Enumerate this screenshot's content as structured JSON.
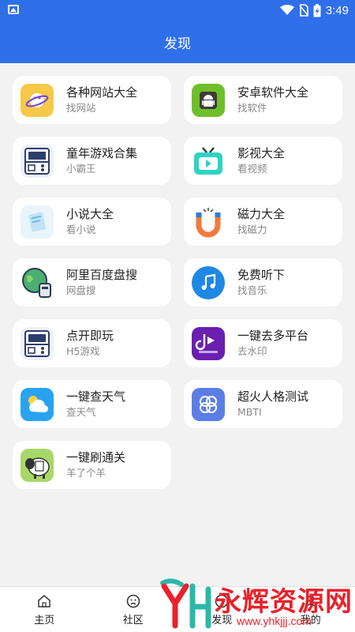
{
  "status_bar": {
    "time": "3:49"
  },
  "header": {
    "title": "发现"
  },
  "cards": [
    {
      "name": "各种网站大全",
      "sub": "找网站",
      "icon": "planet-icon"
    },
    {
      "name": "安卓软件大全",
      "sub": "找软件",
      "icon": "android-icon"
    },
    {
      "name": "童年游戏合集",
      "sub": "小霸王",
      "icon": "handheld-console-icon"
    },
    {
      "name": "影视大全",
      "sub": "看视频",
      "icon": "tv-icon"
    },
    {
      "name": "小说大全",
      "sub": "看小说",
      "icon": "book-icon"
    },
    {
      "name": "磁力大全",
      "sub": "找磁力",
      "icon": "magnet-icon"
    },
    {
      "name": "阿里百度盘搜",
      "sub": "网盘搜",
      "icon": "cloud-drive-icon"
    },
    {
      "name": "免费听下",
      "sub": "找音乐",
      "icon": "music-note-icon"
    },
    {
      "name": "点开即玩",
      "sub": "H5游戏",
      "icon": "handheld-console-icon"
    },
    {
      "name": "一键去多平台",
      "sub": "去水印",
      "icon": "watermark-remove-icon"
    },
    {
      "name": "一键查天气",
      "sub": "查天气",
      "icon": "weather-icon"
    },
    {
      "name": "超火人格测试",
      "sub": "MBTI",
      "icon": "clover-icon"
    },
    {
      "name": "一键刷通关",
      "sub": "羊了个羊",
      "icon": "sheep-game-icon"
    }
  ],
  "tabbar": {
    "home": "主页",
    "community": "社区",
    "discover": "发现",
    "mine": "我的"
  },
  "watermark": {
    "text": "永辉资源网",
    "url": "www.yhkjjj.com"
  },
  "colors": {
    "primary": "#2f6fea",
    "background": "#f2f2f2",
    "watermark": "#e8222b"
  }
}
